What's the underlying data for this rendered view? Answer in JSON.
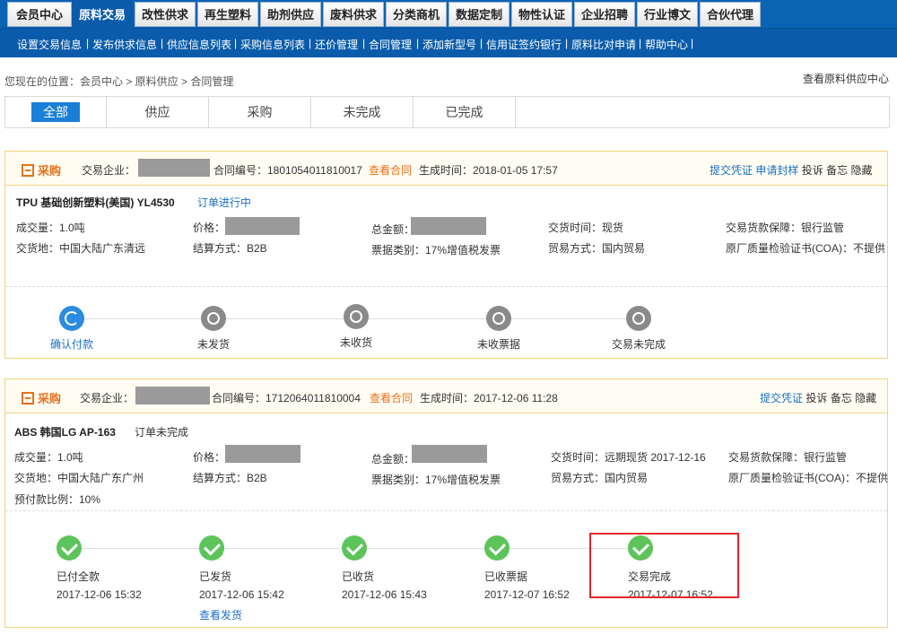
{
  "topnav": [
    "会员中心",
    "原料交易",
    "改性供求",
    "再生塑料",
    "助剂供应",
    "废料供求",
    "分类商机",
    "数据定制",
    "物性认证",
    "企业招聘",
    "行业博文",
    "合伙代理"
  ],
  "subnav": [
    "设置交易信息",
    "发布供求信息",
    "供应信息列表",
    "采购信息列表",
    "还价管理",
    "合同管理",
    "添加新型号",
    "信用证签约银行",
    "原料比对申请",
    "帮助中心"
  ],
  "breadcrumb": "您现在的位置：会员中心 > 原料供应 > 合同管理",
  "supply_center": "查看原料供应中心",
  "filters": [
    "全部",
    "供应",
    "采购",
    "未完成",
    "已完成"
  ],
  "orders": [
    {
      "type": "采购",
      "company_label": "交易企业：",
      "contract_label": "合同编号：1801054011810017",
      "view_contract": "查看合同",
      "created": "生成时间：2018-01-05 17:57",
      "actions": {
        "submit": "提交凭证",
        "sample": "申请封样",
        "complain": "投诉",
        "memo": "备忘",
        "hide": "隐藏"
      },
      "product": "TPU 基础创新塑料(美国) YL4530",
      "status": "订单进行中",
      "fields": {
        "qty": "成交量：1.0吨",
        "price": "价格：",
        "total": "总金额：",
        "delivery_time": "交货时间：现货",
        "guarantee": "交易货款保障：银行监管",
        "place": "交货地：中国大陆广东清远",
        "settle": "结算方式：B2B",
        "invoice": "票据类别：17%增值税发票",
        "trade": "贸易方式：国内贸易",
        "coa": "原厂质量检验证书(COA)：不提供"
      },
      "steps": [
        "确认付款",
        "未发货",
        "未收货",
        "未收票据",
        "交易未完成"
      ]
    },
    {
      "type": "采购",
      "company_label": "交易企业：",
      "contract_label": "合同编号：1712064011810004",
      "view_contract": "查看合同",
      "created": "生成时间：2017-12-06 11:28",
      "actions": {
        "submit": "提交凭证",
        "complain": "投诉",
        "memo": "备忘",
        "hide": "隐藏"
      },
      "product": "ABS 韩国LG AP-163",
      "status": "订单未完成",
      "fields": {
        "qty": "成交量：1.0吨",
        "price": "价格：",
        "total": "总金额：",
        "delivery_time": "交货时间：远期现货 2017-12-16",
        "guarantee": "交易货款保障：银行监管",
        "place": "交货地：中国大陆广东广州",
        "settle": "结算方式：B2B",
        "invoice": "票据类别：17%增值税发票",
        "trade": "贸易方式：国内贸易",
        "coa": "原厂质量检验证书(COA)：不提供",
        "prepay": "预付款比例：10%"
      },
      "steps": [
        {
          "label": "已付全款",
          "time": "2017-12-06 15:32"
        },
        {
          "label": "已发货",
          "time": "2017-12-06 15:42",
          "link": "查看发货"
        },
        {
          "label": "已收货",
          "time": "2017-12-06 15:43"
        },
        {
          "label": "已收票据",
          "time": "2017-12-07 16:52"
        },
        {
          "label": "交易完成",
          "time": "2017-12-07 16:52"
        }
      ]
    }
  ]
}
